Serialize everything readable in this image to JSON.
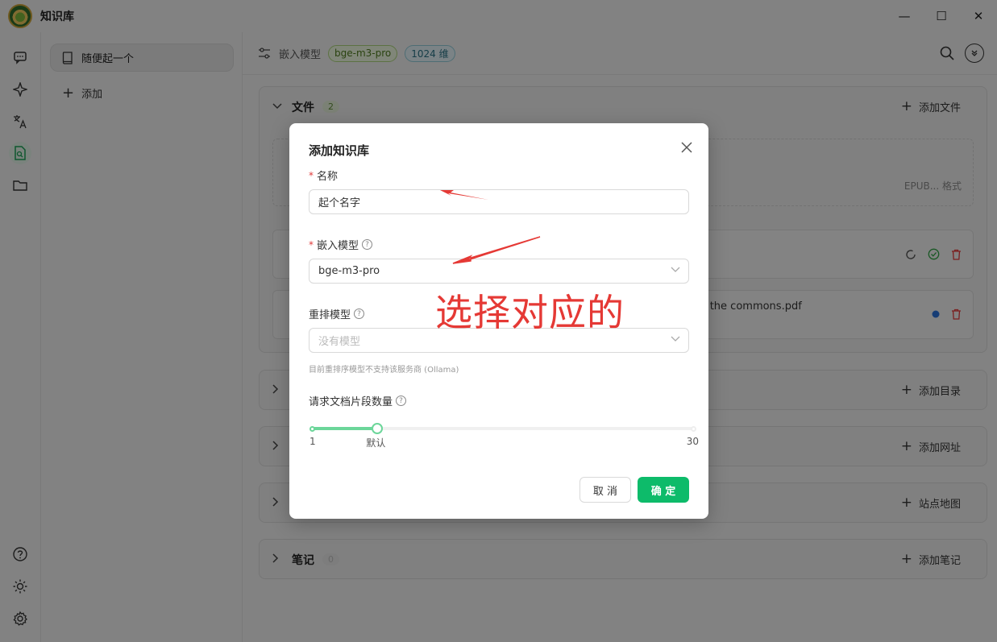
{
  "window": {
    "title": "知识库",
    "minimize": "—",
    "maximize": "☐",
    "close": "✕"
  },
  "rail": {
    "items": [
      "chat-icon",
      "sparkle-icon",
      "translate-icon",
      "knowledge-icon",
      "folder-icon",
      "help-icon",
      "theme-icon",
      "settings-icon"
    ]
  },
  "kb_sidebar": {
    "items": [
      {
        "label": "随便起一个"
      }
    ],
    "add_label": "添加"
  },
  "toolbar": {
    "embed_label": "嵌入模型",
    "model_tag": "bge-m3-pro",
    "dim_tag": "1024 维"
  },
  "sections": {
    "files": {
      "title": "文件",
      "count": "2",
      "action": "添加文件",
      "drop_hint": "EPUB... 格式"
    },
    "directory": {
      "action": "添加目录"
    },
    "url": {
      "action": "添加网址"
    },
    "sitemap": {
      "action": "站点地图"
    },
    "notes": {
      "title": "笔记",
      "count": "0",
      "action": "添加笔记"
    }
  },
  "file_rows": [
    {
      "name": ""
    },
    {
      "name": "f the commons.pdf"
    }
  ],
  "dialog": {
    "title": "添加知识库",
    "name_label": "名称",
    "name_value": "起个名字",
    "embed_label": "嵌入模型",
    "embed_value": "bge-m3-pro",
    "rerank_label": "重排模型",
    "rerank_placeholder": "没有模型",
    "rerank_help": "目前重排序模型不支持该服务商 (Ollama)",
    "docs_label": "请求文档片段数量",
    "slider_min": "1",
    "slider_default": "默认",
    "slider_max": "30",
    "slider_value": 6,
    "slider_range": [
      1,
      30
    ],
    "cancel": "取 消",
    "ok": "确 定"
  },
  "annotation": {
    "text": "选择对应的",
    "color": "#e53935"
  },
  "colors": {
    "accent": "#0dbb6a",
    "required": "#e03b3b",
    "slider": "#6cd69a"
  }
}
